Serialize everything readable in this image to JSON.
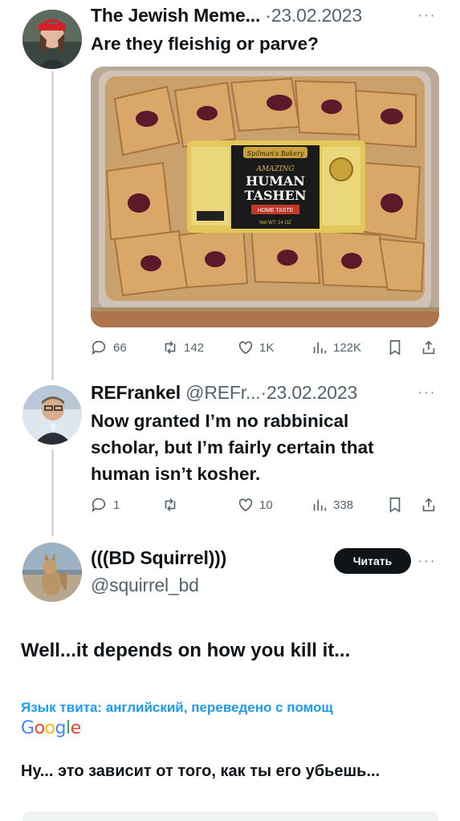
{
  "tweets": [
    {
      "name": "The Jewish Meme...",
      "separator": "·",
      "date": "23.02.2023",
      "text": "Are they fleishig or parve?",
      "media_label": {
        "brand": "Spilman's Bakery",
        "line1": "AMAZING",
        "line2": "HUMAN",
        "line3": "TASHEN",
        "line4": "HOME TASTE",
        "weight": "Net WT: 14 OZ"
      },
      "stats": {
        "replies": "66",
        "retweets": "142",
        "likes": "1K",
        "views": "122K"
      }
    },
    {
      "name": "REFrankel",
      "handle": "@REFr...",
      "separator": "·",
      "date": "23.02.2023",
      "text_lines": [
        "Now granted I’m no rabbinical",
        "scholar, but I’m fairly certain that",
        "human isn’t kosher."
      ],
      "stats": {
        "replies": "1",
        "retweets": "",
        "likes": "10",
        "views": "338"
      }
    }
  ],
  "focus": {
    "name": "(((BD Squirrel)))",
    "handle": "@squirrel_bd",
    "follow_label": "Читать",
    "text": "Well...it depends on how you kill it...",
    "translation_note": "Язык твита: английский, переведено с помощ",
    "google_label": "Google",
    "translated_text": "Ну... это зависит от того, как ты его убьешь..."
  },
  "more_glyph": "···",
  "colors": {
    "accent": "#1d9bf0",
    "text": "#0f1419",
    "secondary": "#536471",
    "thread": "#cfd9de"
  }
}
